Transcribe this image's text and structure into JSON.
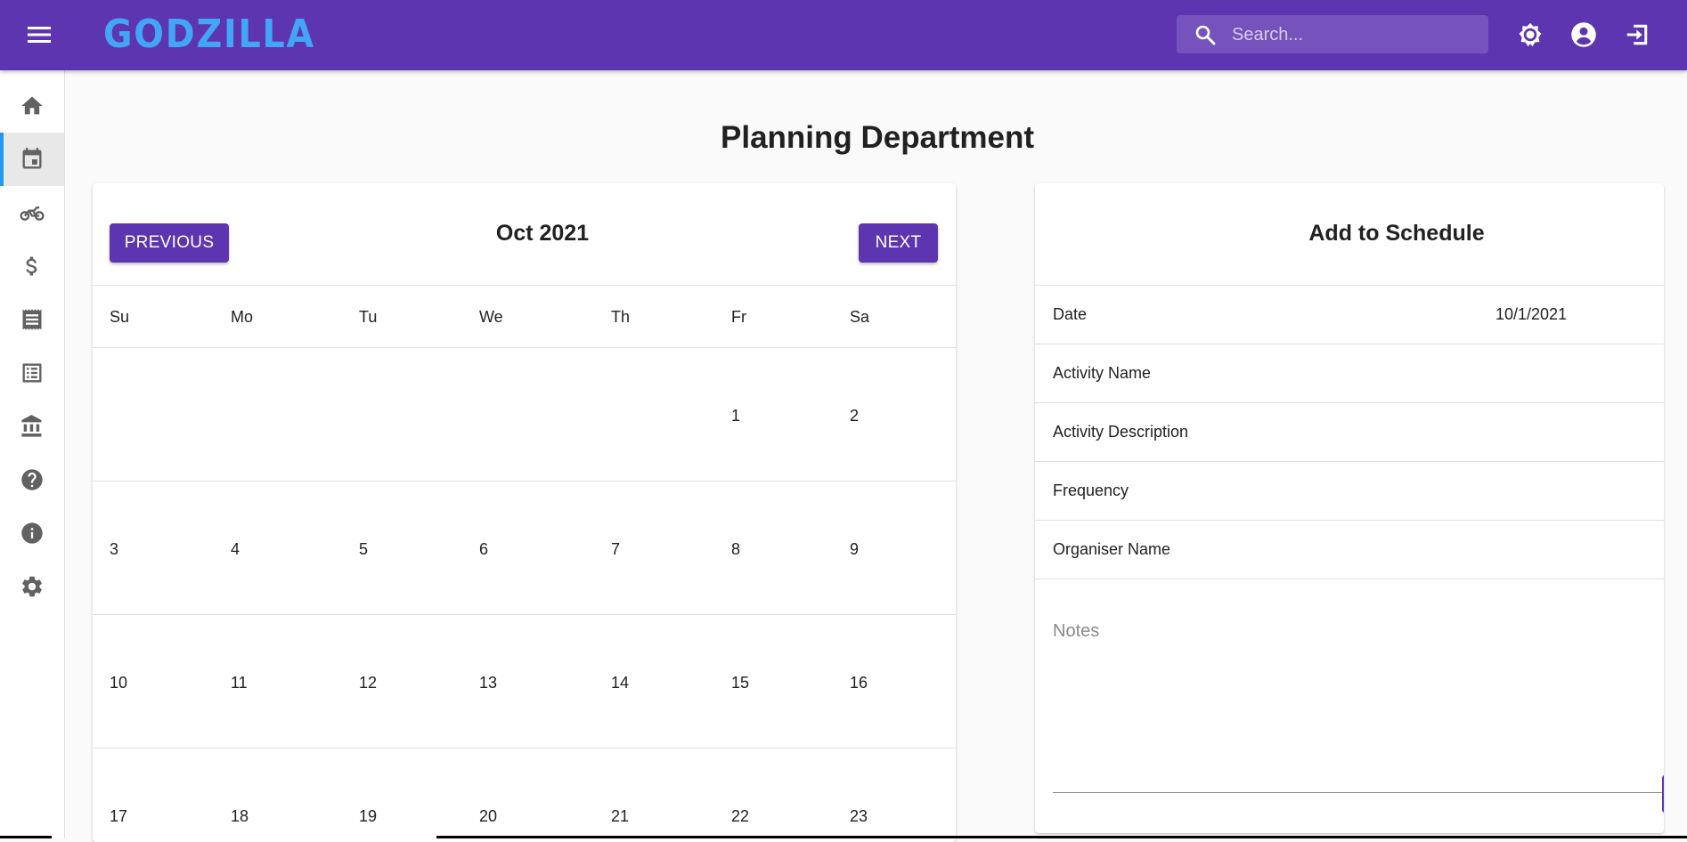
{
  "appbar": {
    "brand": "GODZILLA",
    "search_placeholder": "Search..."
  },
  "page": {
    "title": "Planning Department"
  },
  "calendar": {
    "month_label": "Oct 2021",
    "prev_label": "PREVIOUS",
    "next_label": "NEXT",
    "weekdays": [
      "Su",
      "Mo",
      "Tu",
      "We",
      "Th",
      "Fr",
      "Sa"
    ],
    "weeks": [
      [
        "",
        "",
        "",
        "",
        "",
        "1",
        "2"
      ],
      [
        "3",
        "4",
        "5",
        "6",
        "7",
        "8",
        "9"
      ],
      [
        "10",
        "11",
        "12",
        "13",
        "14",
        "15",
        "16"
      ],
      [
        "17",
        "18",
        "19",
        "20",
        "21",
        "22",
        "23"
      ]
    ]
  },
  "schedule": {
    "title": "Add to Schedule",
    "fields": [
      {
        "label": "Date",
        "value": "10/1/2021"
      },
      {
        "label": "Activity Name",
        "value": ""
      },
      {
        "label": "Activity Description",
        "value": ""
      },
      {
        "label": "Frequency",
        "value": ""
      },
      {
        "label": "Organiser Name",
        "value": ""
      }
    ],
    "notes_label": "Notes"
  },
  "colors": {
    "primary": "#5e35b1",
    "brand": "#42a5f5",
    "active_indicator": "#2196f3"
  },
  "icons": {
    "sidebar": [
      "home-icon",
      "calendar-icon",
      "motorbike-icon",
      "dollar-icon",
      "receipt-icon",
      "list-icon",
      "bank-icon",
      "help-icon",
      "info-icon",
      "settings-icon"
    ],
    "topbar": [
      "brightness-icon",
      "account-icon",
      "logout-icon"
    ]
  }
}
